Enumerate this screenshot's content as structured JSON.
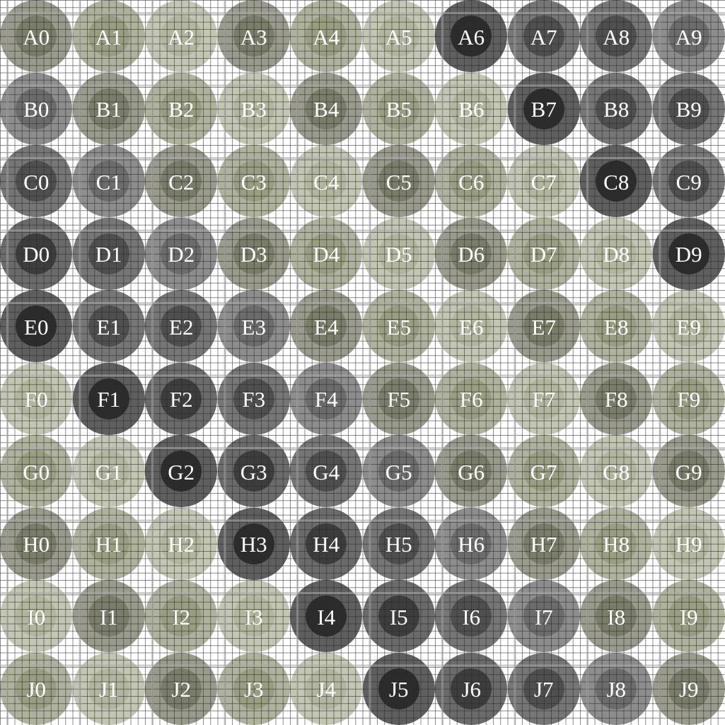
{
  "board": {
    "rows": [
      "A",
      "B",
      "C",
      "D",
      "E",
      "F",
      "G",
      "H",
      "I",
      "J"
    ],
    "columns": [
      "0",
      "1",
      "2",
      "3",
      "4",
      "5",
      "6",
      "7",
      "8",
      "9"
    ],
    "palette": {
      "L1": {
        "outer": "#c4c6b4",
        "inner": "#b3b69f"
      },
      "L2": {
        "outer": "#afb29c",
        "inner": "#999d81"
      },
      "L3": {
        "outer": "#9a9b8d",
        "inner": "#7b7d6b"
      },
      "L4": {
        "outer": "#8d8d8e",
        "inner": "#6c6c6d"
      },
      "L5": {
        "outer": "#767677",
        "inner": "#4f4f50"
      },
      "L5b": {
        "outer": "#6b6b6b",
        "inner": "#3d3d3d"
      },
      "L6": {
        "outer": "#5f5f5f",
        "inner": "#2c2c2c"
      }
    },
    "label_color": "#ffffff",
    "cells": [
      [
        "L3",
        "L2",
        "L1",
        "L3",
        "L2",
        "L1",
        "L6",
        "L5",
        "L5",
        "L4"
      ],
      [
        "L4",
        "L3",
        "L2",
        "L1",
        "L3",
        "L2",
        "L1",
        "L6",
        "L5",
        "L5"
      ],
      [
        "L5",
        "L4",
        "L3",
        "L2",
        "L1",
        "L3",
        "L2",
        "L1",
        "L6",
        "L5"
      ],
      [
        "L5b",
        "L5",
        "L4",
        "L3",
        "L2",
        "L1",
        "L3",
        "L2",
        "L1",
        "L6"
      ],
      [
        "L6",
        "L5",
        "L5",
        "L4",
        "L3",
        "L2",
        "L1",
        "L3",
        "L2",
        "L1"
      ],
      [
        "L1",
        "L6",
        "L5b",
        "L5",
        "L4",
        "L3",
        "L2",
        "L1",
        "L3",
        "L2"
      ],
      [
        "L2",
        "L1",
        "L6",
        "L5b",
        "L5",
        "L4",
        "L3",
        "L2",
        "L1",
        "L3"
      ],
      [
        "L3",
        "L2",
        "L1",
        "L6",
        "L5b",
        "L5",
        "L4",
        "L3",
        "L2",
        "L1"
      ],
      [
        "L1",
        "L3",
        "L2",
        "L1",
        "L6",
        "L5b",
        "L5",
        "L4",
        "L3",
        "L2"
      ],
      [
        "L2",
        "L1",
        "L3",
        "L2",
        "L1",
        "L6",
        "L5b",
        "L5",
        "L4",
        "L3"
      ]
    ]
  }
}
